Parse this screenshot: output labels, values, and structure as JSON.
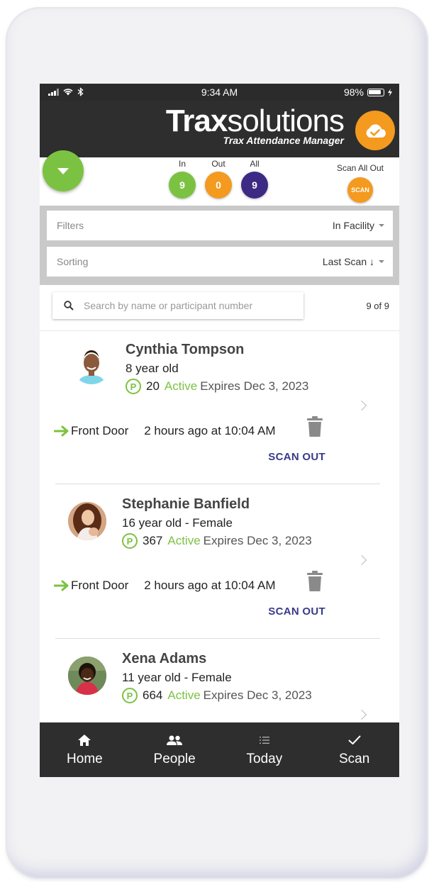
{
  "status_bar": {
    "time": "9:34 AM",
    "battery": "98%"
  },
  "header": {
    "logo_bold": "Trax",
    "logo_light": "solutions",
    "logo_sub": "Trax Attendance Manager",
    "cloud_icon": "cloud-check-icon"
  },
  "counters": {
    "in_label": "In",
    "in_value": "9",
    "out_label": "Out",
    "out_value": "0",
    "all_label": "All",
    "all_value": "9",
    "scan_all_label": "Scan All Out",
    "scan_btn": "SCAN"
  },
  "filters": {
    "filter_label": "Filters",
    "filter_value": "In Facility",
    "sort_label": "Sorting",
    "sort_value": "Last Scan ↓"
  },
  "search": {
    "placeholder": "Search by name or participant number",
    "count": "9 of 9"
  },
  "people": [
    {
      "name": "Cynthia Tompson",
      "age": "8 year old",
      "badge": "P",
      "number": "20",
      "status": "Active",
      "expires": "Expires Dec 3, 2023",
      "location": "Front Door",
      "last_scan": "2 hours ago at 10:04 AM",
      "action": "SCAN OUT"
    },
    {
      "name": "Stephanie Banfield",
      "age": "16 year old - Female",
      "badge": "P",
      "number": "367",
      "status": "Active",
      "expires": "Expires Dec 3, 2023",
      "location": "Front Door",
      "last_scan": "2 hours ago at 10:04 AM",
      "action": "SCAN OUT"
    },
    {
      "name": "Xena Adams",
      "age": "11 year old - Female",
      "badge": "P",
      "number": "664",
      "status": "Active",
      "expires": "Expires Dec 3, 2023"
    }
  ],
  "nav": {
    "home": "Home",
    "people": "People",
    "today": "Today",
    "scan": "Scan"
  },
  "colors": {
    "green": "#7cc242",
    "orange": "#f39a1f",
    "purple": "#3d2a84",
    "header_dark": "#2e2e2e"
  }
}
